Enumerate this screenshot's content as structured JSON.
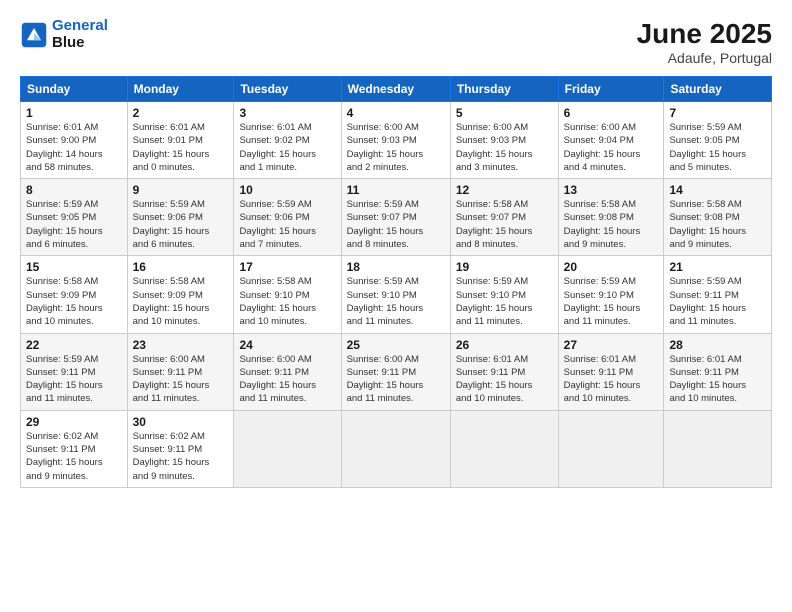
{
  "logo": {
    "line1": "General",
    "line2": "Blue"
  },
  "title": "June 2025",
  "subtitle": "Adaufe, Portugal",
  "weekdays": [
    "Sunday",
    "Monday",
    "Tuesday",
    "Wednesday",
    "Thursday",
    "Friday",
    "Saturday"
  ],
  "weeks": [
    [
      {
        "day": "1",
        "info": "Sunrise: 6:01 AM\nSunset: 9:00 PM\nDaylight: 14 hours\nand 58 minutes."
      },
      {
        "day": "2",
        "info": "Sunrise: 6:01 AM\nSunset: 9:01 PM\nDaylight: 15 hours\nand 0 minutes."
      },
      {
        "day": "3",
        "info": "Sunrise: 6:01 AM\nSunset: 9:02 PM\nDaylight: 15 hours\nand 1 minute."
      },
      {
        "day": "4",
        "info": "Sunrise: 6:00 AM\nSunset: 9:03 PM\nDaylight: 15 hours\nand 2 minutes."
      },
      {
        "day": "5",
        "info": "Sunrise: 6:00 AM\nSunset: 9:03 PM\nDaylight: 15 hours\nand 3 minutes."
      },
      {
        "day": "6",
        "info": "Sunrise: 6:00 AM\nSunset: 9:04 PM\nDaylight: 15 hours\nand 4 minutes."
      },
      {
        "day": "7",
        "info": "Sunrise: 5:59 AM\nSunset: 9:05 PM\nDaylight: 15 hours\nand 5 minutes."
      }
    ],
    [
      {
        "day": "8",
        "info": "Sunrise: 5:59 AM\nSunset: 9:05 PM\nDaylight: 15 hours\nand 6 minutes."
      },
      {
        "day": "9",
        "info": "Sunrise: 5:59 AM\nSunset: 9:06 PM\nDaylight: 15 hours\nand 6 minutes."
      },
      {
        "day": "10",
        "info": "Sunrise: 5:59 AM\nSunset: 9:06 PM\nDaylight: 15 hours\nand 7 minutes."
      },
      {
        "day": "11",
        "info": "Sunrise: 5:59 AM\nSunset: 9:07 PM\nDaylight: 15 hours\nand 8 minutes."
      },
      {
        "day": "12",
        "info": "Sunrise: 5:58 AM\nSunset: 9:07 PM\nDaylight: 15 hours\nand 8 minutes."
      },
      {
        "day": "13",
        "info": "Sunrise: 5:58 AM\nSunset: 9:08 PM\nDaylight: 15 hours\nand 9 minutes."
      },
      {
        "day": "14",
        "info": "Sunrise: 5:58 AM\nSunset: 9:08 PM\nDaylight: 15 hours\nand 9 minutes."
      }
    ],
    [
      {
        "day": "15",
        "info": "Sunrise: 5:58 AM\nSunset: 9:09 PM\nDaylight: 15 hours\nand 10 minutes."
      },
      {
        "day": "16",
        "info": "Sunrise: 5:58 AM\nSunset: 9:09 PM\nDaylight: 15 hours\nand 10 minutes."
      },
      {
        "day": "17",
        "info": "Sunrise: 5:58 AM\nSunset: 9:10 PM\nDaylight: 15 hours\nand 10 minutes."
      },
      {
        "day": "18",
        "info": "Sunrise: 5:59 AM\nSunset: 9:10 PM\nDaylight: 15 hours\nand 11 minutes."
      },
      {
        "day": "19",
        "info": "Sunrise: 5:59 AM\nSunset: 9:10 PM\nDaylight: 15 hours\nand 11 minutes."
      },
      {
        "day": "20",
        "info": "Sunrise: 5:59 AM\nSunset: 9:10 PM\nDaylight: 15 hours\nand 11 minutes."
      },
      {
        "day": "21",
        "info": "Sunrise: 5:59 AM\nSunset: 9:11 PM\nDaylight: 15 hours\nand 11 minutes."
      }
    ],
    [
      {
        "day": "22",
        "info": "Sunrise: 5:59 AM\nSunset: 9:11 PM\nDaylight: 15 hours\nand 11 minutes."
      },
      {
        "day": "23",
        "info": "Sunrise: 6:00 AM\nSunset: 9:11 PM\nDaylight: 15 hours\nand 11 minutes."
      },
      {
        "day": "24",
        "info": "Sunrise: 6:00 AM\nSunset: 9:11 PM\nDaylight: 15 hours\nand 11 minutes."
      },
      {
        "day": "25",
        "info": "Sunrise: 6:00 AM\nSunset: 9:11 PM\nDaylight: 15 hours\nand 11 minutes."
      },
      {
        "day": "26",
        "info": "Sunrise: 6:01 AM\nSunset: 9:11 PM\nDaylight: 15 hours\nand 10 minutes."
      },
      {
        "day": "27",
        "info": "Sunrise: 6:01 AM\nSunset: 9:11 PM\nDaylight: 15 hours\nand 10 minutes."
      },
      {
        "day": "28",
        "info": "Sunrise: 6:01 AM\nSunset: 9:11 PM\nDaylight: 15 hours\nand 10 minutes."
      }
    ],
    [
      {
        "day": "29",
        "info": "Sunrise: 6:02 AM\nSunset: 9:11 PM\nDaylight: 15 hours\nand 9 minutes."
      },
      {
        "day": "30",
        "info": "Sunrise: 6:02 AM\nSunset: 9:11 PM\nDaylight: 15 hours\nand 9 minutes."
      },
      null,
      null,
      null,
      null,
      null
    ]
  ]
}
